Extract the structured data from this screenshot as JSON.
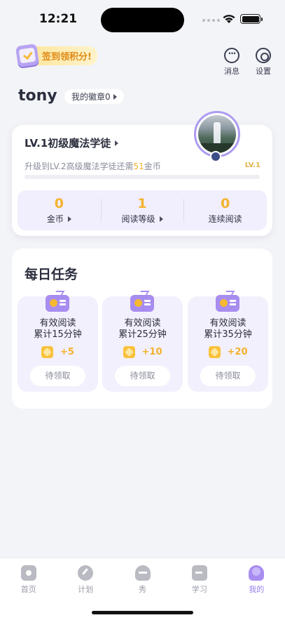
{
  "status_bar": {
    "time": "12:21"
  },
  "header": {
    "checkin_label": "签到领积分!",
    "actions": [
      {
        "label": "消息",
        "icon": "chat-bubble-icon"
      },
      {
        "label": "设置",
        "icon": "gear-icon"
      }
    ]
  },
  "user": {
    "name": "tony",
    "badge_label": "我的徽章0"
  },
  "level": {
    "title": "LV.1初级魔法学徒",
    "upgrade_prefix": "升级到LV.2高级魔法学徒还需",
    "upgrade_coins": "51",
    "upgrade_suffix": "金币",
    "tag": "LV.1",
    "progress": 0
  },
  "stats": [
    {
      "value": "0",
      "label": "金币",
      "has_arrow": true
    },
    {
      "value": "1",
      "label": "阅读等级",
      "has_arrow": true
    },
    {
      "value": "0",
      "label": "连续阅读",
      "has_arrow": false
    }
  ],
  "tasks": {
    "title": "每日任务",
    "items": [
      {
        "line1": "有效阅读",
        "line2": "累计15分钟",
        "reward": "+5",
        "button": "待领取"
      },
      {
        "line1": "有效阅读",
        "line2": "累计25分钟",
        "reward": "+10",
        "button": "待领取"
      },
      {
        "line1": "有效阅读",
        "line2": "累计35分钟",
        "reward": "+20",
        "button": "待领取"
      }
    ]
  },
  "tab_bar": {
    "items": [
      {
        "label": "首页",
        "icon": "home-icon"
      },
      {
        "label": "计划",
        "icon": "plan-icon"
      },
      {
        "label": "秀",
        "icon": "show-icon"
      },
      {
        "label": "学习",
        "icon": "study-icon"
      },
      {
        "label": "我的",
        "icon": "profile-icon"
      }
    ],
    "active_index": 4
  },
  "colors": {
    "accent": "#a88df0",
    "gold": "#f4b22e",
    "background": "#f3f4f7"
  }
}
